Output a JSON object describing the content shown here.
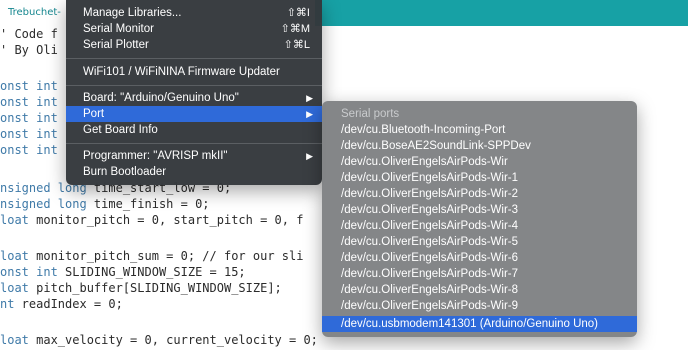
{
  "window": {
    "tab_label": "Trebuchet-"
  },
  "code": [
    {
      "kw": "",
      "rest": "' Code f"
    },
    {
      "kw": "",
      "rest": "' By Oli"
    },
    {
      "kw": "",
      "rest": ""
    },
    {
      "kw": "onst",
      "rest": " int"
    },
    {
      "kw": "onst",
      "rest": " int"
    },
    {
      "kw": "onst",
      "rest": " int"
    },
    {
      "kw": "onst",
      "rest": " int"
    },
    {
      "kw": "onst",
      "rest": " int"
    },
    {
      "kw": "",
      "rest": ""
    },
    {
      "kw": "nsigned long",
      "rest": " time_start_low = 0;"
    },
    {
      "kw": "nsigned long",
      "rest": " time_finish = 0;"
    },
    {
      "kw": "loat",
      "rest": " monitor_pitch = 0, start_pitch = 0, f"
    },
    {
      "kw": "",
      "rest": ""
    },
    {
      "kw": "loat",
      "rest": " monitor_pitch_sum = 0; // for our sli"
    },
    {
      "kw": "onst int",
      "rest": " SLIDING_WINDOW_SIZE = 15;"
    },
    {
      "kw": "loat",
      "rest": " pitch_buffer[SLIDING_WINDOW_SIZE];"
    },
    {
      "kw": "nt",
      "rest": " readIndex = 0;"
    },
    {
      "kw": "",
      "rest": ""
    },
    {
      "kw": "loat",
      "rest": " max_velocity = 0, current_velocity = 0;"
    }
  ],
  "tools_menu": {
    "items": [
      {
        "label": "Manage Libraries...",
        "shortcut": "⇧⌘I"
      },
      {
        "label": "Serial Monitor",
        "shortcut": "⇧⌘M"
      },
      {
        "label": "Serial Plotter",
        "shortcut": "⇧⌘L"
      },
      {
        "label": "WiFi101 / WiFiNINA Firmware Updater",
        "shortcut": ""
      },
      {
        "label": "Board: \"Arduino/Genuino Uno\"",
        "shortcut": "",
        "submenu": true
      },
      {
        "label": "Port",
        "shortcut": "",
        "submenu": true,
        "selected": true
      },
      {
        "label": "Get Board Info",
        "shortcut": ""
      },
      {
        "label": "Programmer: \"AVRISP mkII\"",
        "shortcut": "",
        "submenu": true
      },
      {
        "label": "Burn Bootloader",
        "shortcut": ""
      }
    ]
  },
  "port_submenu": {
    "header": "Serial ports",
    "ports": [
      "/dev/cu.Bluetooth-Incoming-Port",
      "/dev/cu.BoseAE2SoundLink-SPPDev",
      "/dev/cu.OliverEngelsAirPods-Wir",
      "/dev/cu.OliverEngelsAirPods-Wir-1",
      "/dev/cu.OliverEngelsAirPods-Wir-2",
      "/dev/cu.OliverEngelsAirPods-Wir-3",
      "/dev/cu.OliverEngelsAirPods-Wir-4",
      "/dev/cu.OliverEngelsAirPods-Wir-5",
      "/dev/cu.OliverEngelsAirPods-Wir-6",
      "/dev/cu.OliverEngelsAirPods-Wir-7",
      "/dev/cu.OliverEngelsAirPods-Wir-8",
      "/dev/cu.OliverEngelsAirPods-Wir-9",
      "/dev/cu.usbmodem141301 (Arduino/Genuino Uno)"
    ],
    "selected_index": 12
  },
  "colors": {
    "accent_teal": "#17a1a5",
    "menu_highlight": "#2f6ad9",
    "keyword": "#3f7aa8"
  }
}
